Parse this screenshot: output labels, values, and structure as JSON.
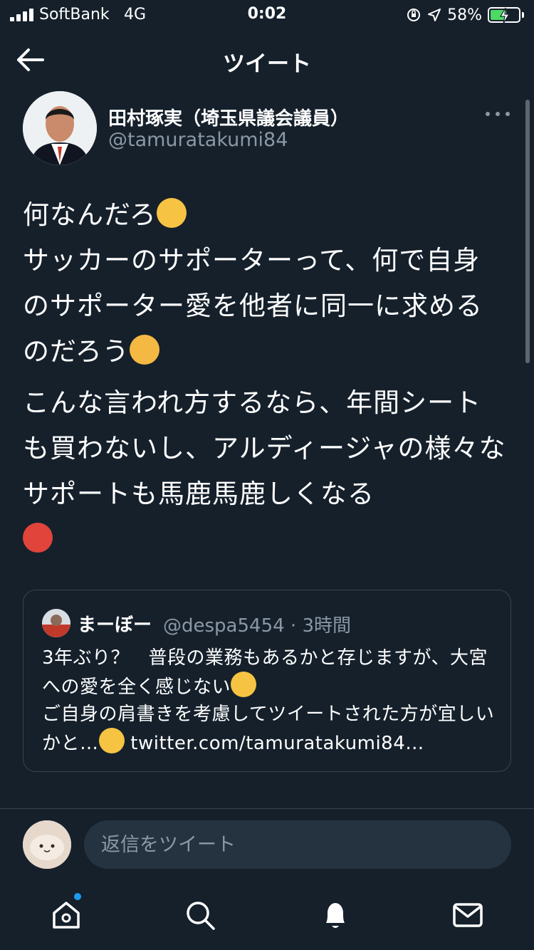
{
  "status_bar": {
    "carrier": "SoftBank",
    "network": "4G",
    "time": "0:02",
    "battery_percent": "58%",
    "battery_level": 0.58
  },
  "header": {
    "title": "ツイート"
  },
  "tweet": {
    "author_name": "田村琢実（埼玉県議会議員）",
    "author_handle": "@tamuratakumi84",
    "line_1": "何なんだろ",
    "line_2": "サッカーのサポーターって、何で自身のサポーター愛を他者に同一に求めるのだろう",
    "line_3": "こんな言われ方するなら、年間シートも買わないし、アルディージャの様々なサポートも馬鹿馬鹿しくなる"
  },
  "quote": {
    "name": "まーぼー",
    "handle_time": "@despa5454 · 3時間",
    "text_1": "3年ぶり？　普段の業務もあるかと存じますが、大宮への愛を全く感じない",
    "text_2": "ご自身の肩書きを考慮してツイートされた方が宜しいかと…",
    "link": "twitter.com/tamuratakumi84…"
  },
  "reply": {
    "placeholder": "返信をツイート"
  },
  "colors": {
    "background": "#15202b",
    "accent": "#1d9bf0",
    "secondary_text": "#8b98a5",
    "border": "#38444d"
  },
  "icons": [
    "back-arrow-icon",
    "more-icon",
    "home-icon",
    "search-icon",
    "bell-icon",
    "mail-icon"
  ]
}
